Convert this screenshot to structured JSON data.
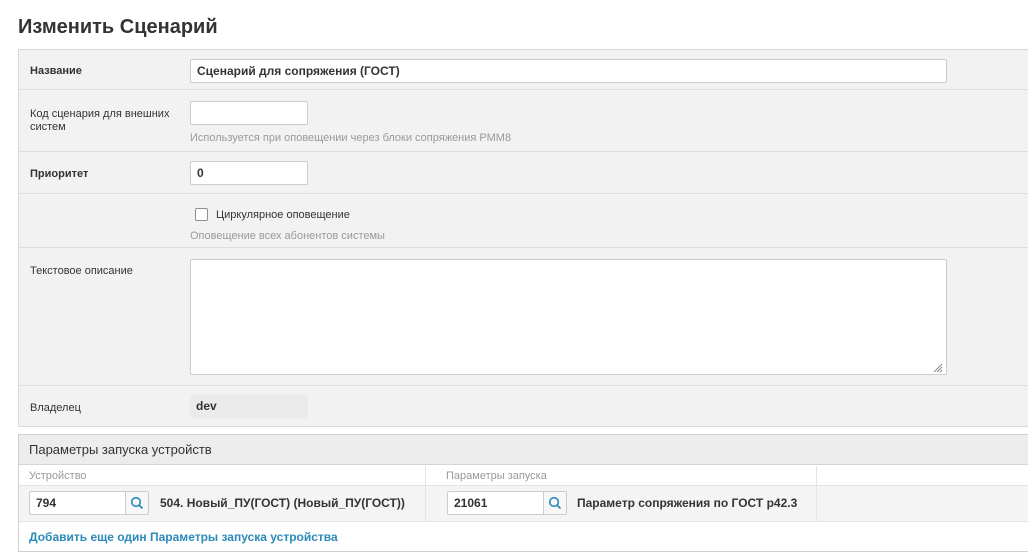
{
  "page": {
    "title": "Изменить Сценарий"
  },
  "form": {
    "name": {
      "label": "Название",
      "value": "Сценарий для сопряжения (ГОСТ)"
    },
    "ext_code": {
      "label": "Код сценария для внешних систем",
      "value": "",
      "hint": "Используется при оповещении через блоки сопряжения РММ8"
    },
    "priority": {
      "label": "Приоритет",
      "value": "0"
    },
    "circular": {
      "checkbox_label": "Циркулярное оповещение",
      "checked": false,
      "hint": "Оповещение всех абонентов системы"
    },
    "description": {
      "label": "Текстовое описание",
      "value": ""
    },
    "owner": {
      "label": "Владелец",
      "value": "dev"
    }
  },
  "device_params": {
    "title": "Параметры запуска устройств",
    "col_device": "Устройство",
    "col_params": "Параметры запуска",
    "rows": [
      {
        "device_id": "794",
        "device_name": "504. Новый_ПУ(ГОСТ) (Новый_ПУ(ГОСТ))",
        "param_id": "21061",
        "param_name": "Параметр сопряжения по ГОСТ p42.3"
      }
    ],
    "add_link": "Добавить еще один Параметры запуска устройства"
  }
}
